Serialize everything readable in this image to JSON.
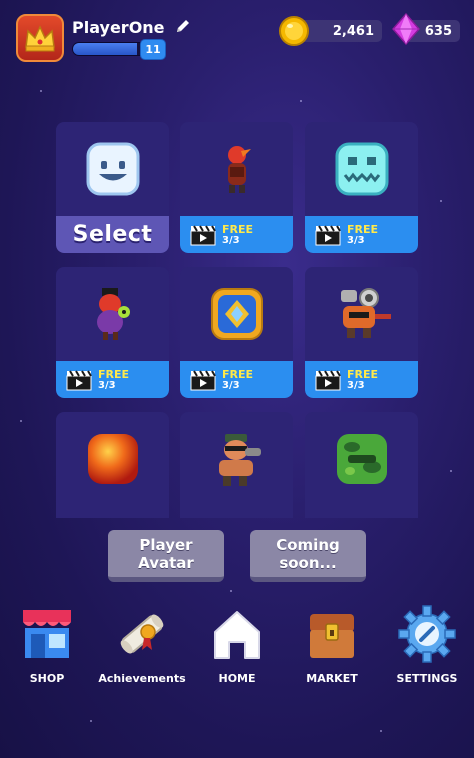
{
  "player": {
    "name": "PlayerOne",
    "level": "11",
    "level_progress": 0.92
  },
  "currency": {
    "coins": "2,461",
    "gems": "635"
  },
  "colors": {
    "free_button": "#2b8ef0",
    "free_text": "#ffe94a",
    "select_button": "#5e56b5",
    "panel": "#2d2475"
  },
  "avatars": [
    {
      "name": "smiley-cube",
      "footer": "select",
      "label": "Select"
    },
    {
      "name": "red-bird-hooded",
      "footer": "free",
      "label": "FREE",
      "count": "3/3"
    },
    {
      "name": "cyan-ghost-cube",
      "footer": "free",
      "label": "FREE",
      "count": "3/3"
    },
    {
      "name": "purple-hat-creature",
      "footer": "free",
      "label": "FREE",
      "count": "3/3"
    },
    {
      "name": "blue-gold-emblem",
      "footer": "free",
      "label": "FREE",
      "count": "3/3"
    },
    {
      "name": "robot-mech",
      "footer": "free",
      "label": "FREE",
      "count": "3/3"
    },
    {
      "name": "fire-ball",
      "footer": "none"
    },
    {
      "name": "soldier-gunner",
      "footer": "none"
    },
    {
      "name": "green-camo-cube",
      "footer": "none"
    }
  ],
  "buttons": {
    "player_avatar": "Player\nAvatar",
    "coming_soon": "Coming\nsoon..."
  },
  "nav": [
    {
      "label": "SHOP",
      "icon": "shop-icon"
    },
    {
      "label": "Achievements",
      "icon": "scroll-icon"
    },
    {
      "label": "HOME",
      "icon": "home-icon"
    },
    {
      "label": "MARKET",
      "icon": "chest-icon"
    },
    {
      "label": "SETTINGS",
      "icon": "gear-icon"
    }
  ]
}
